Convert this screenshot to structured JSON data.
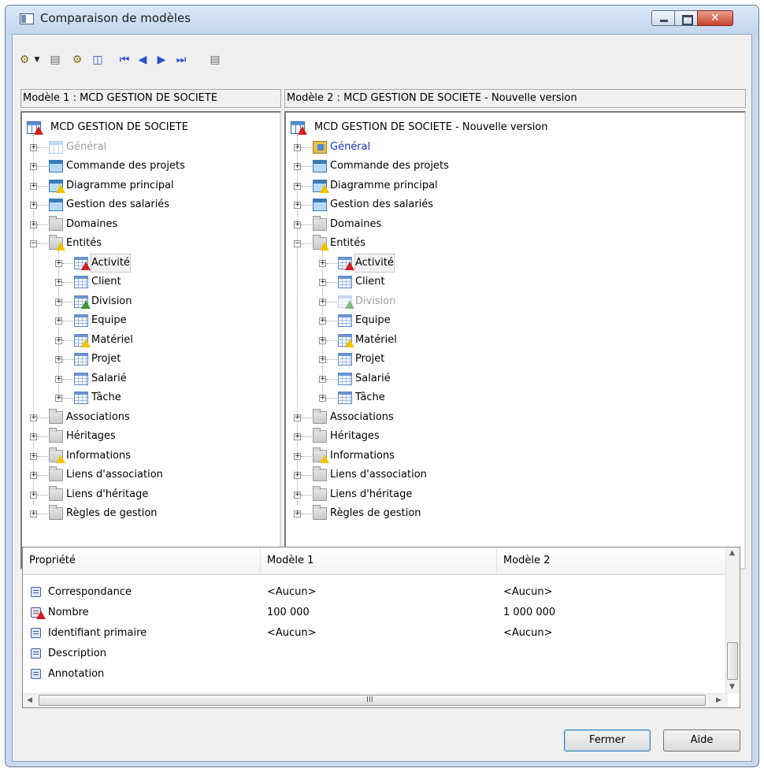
{
  "window": {
    "title": "Comparaison de modèles"
  },
  "toolbar": {
    "icons": [
      "options-icon",
      "dropdown-icon",
      "properties-icon",
      "filter-icon",
      "split-icon",
      "first-icon",
      "previous-icon",
      "next-icon",
      "last-icon",
      "report-icon"
    ]
  },
  "model1": {
    "header": "Modèle 1 : MCD GESTION DE SOCIETE",
    "root": "MCD GESTION DE SOCIETE",
    "items": [
      {
        "label": "Général",
        "icon": "model",
        "state": "faded",
        "level": 1
      },
      {
        "label": "Commande des projets",
        "icon": "diagram",
        "state": "normal",
        "level": 1
      },
      {
        "label": "Diagramme principal",
        "icon": "diagram",
        "state": "warn",
        "level": 1
      },
      {
        "label": "Gestion des salariés",
        "icon": "diagram",
        "state": "normal",
        "level": 1
      },
      {
        "label": "Domaines",
        "icon": "folder",
        "state": "normal",
        "level": 1
      },
      {
        "label": "Entités",
        "icon": "folder",
        "state": "warn",
        "level": 1,
        "expanded": true
      },
      {
        "label": "Activité",
        "icon": "table",
        "state": "error",
        "level": 2,
        "selected": true
      },
      {
        "label": "Client",
        "icon": "table",
        "state": "normal",
        "level": 2
      },
      {
        "label": "Division",
        "icon": "table",
        "state": "added",
        "level": 2
      },
      {
        "label": "Equipe",
        "icon": "table",
        "state": "normal",
        "level": 2
      },
      {
        "label": "Matériel",
        "icon": "table",
        "state": "warn",
        "level": 2
      },
      {
        "label": "Projet",
        "icon": "table",
        "state": "normal",
        "level": 2
      },
      {
        "label": "Salarié",
        "icon": "table",
        "state": "normal",
        "level": 2
      },
      {
        "label": "Tâche",
        "icon": "table",
        "state": "normal",
        "level": 2
      },
      {
        "label": "Associations",
        "icon": "folder",
        "state": "normal",
        "level": 1
      },
      {
        "label": "Héritages",
        "icon": "folder",
        "state": "normal",
        "level": 1
      },
      {
        "label": "Informations",
        "icon": "folder",
        "state": "warn",
        "level": 1
      },
      {
        "label": "Liens d'association",
        "icon": "folder",
        "state": "normal",
        "level": 1
      },
      {
        "label": "Liens d'héritage",
        "icon": "folder",
        "state": "normal",
        "level": 1
      },
      {
        "label": "Règles de gestion",
        "icon": "folder",
        "state": "normal",
        "level": 1
      }
    ]
  },
  "model2": {
    "header": "Modèle 2 : MCD GESTION DE SOCIETE - Nouvelle version",
    "root": "MCD GESTION DE SOCIETE - Nouvelle version",
    "items": [
      {
        "label": "Général",
        "icon": "pkg",
        "state": "blue",
        "level": 1
      },
      {
        "label": "Commande des projets",
        "icon": "diagram",
        "state": "normal",
        "level": 1
      },
      {
        "label": "Diagramme principal",
        "icon": "diagram",
        "state": "warn",
        "level": 1
      },
      {
        "label": "Gestion des salariés",
        "icon": "diagram",
        "state": "normal",
        "level": 1
      },
      {
        "label": "Domaines",
        "icon": "folder",
        "state": "normal",
        "level": 1
      },
      {
        "label": "Entités",
        "icon": "folder",
        "state": "warn",
        "level": 1,
        "expanded": true
      },
      {
        "label": "Activité",
        "icon": "table",
        "state": "error",
        "level": 2,
        "selected": true
      },
      {
        "label": "Client",
        "icon": "table",
        "state": "normal",
        "level": 2
      },
      {
        "label": "Division",
        "icon": "table",
        "state": "removed",
        "level": 2
      },
      {
        "label": "Equipe",
        "icon": "table",
        "state": "normal",
        "level": 2
      },
      {
        "label": "Matériel",
        "icon": "table",
        "state": "warn",
        "level": 2
      },
      {
        "label": "Projet",
        "icon": "table",
        "state": "normal",
        "level": 2
      },
      {
        "label": "Salarié",
        "icon": "table",
        "state": "normal",
        "level": 2
      },
      {
        "label": "Tâche",
        "icon": "table",
        "state": "normal",
        "level": 2
      },
      {
        "label": "Associations",
        "icon": "folder",
        "state": "normal",
        "level": 1
      },
      {
        "label": "Héritages",
        "icon": "folder",
        "state": "normal",
        "level": 1
      },
      {
        "label": "Informations",
        "icon": "folder",
        "state": "warn",
        "level": 1
      },
      {
        "label": "Liens d'association",
        "icon": "folder",
        "state": "normal",
        "level": 1
      },
      {
        "label": "Liens d'héritage",
        "icon": "folder",
        "state": "normal",
        "level": 1
      },
      {
        "label": "Règles de gestion",
        "icon": "folder",
        "state": "normal",
        "level": 1
      }
    ]
  },
  "properties": {
    "columns": [
      "Propriété",
      "Modèle 1",
      "Modèle 2"
    ],
    "rows": [
      {
        "name": "Correspondance",
        "m1": "<Aucun>",
        "m2": "<Aucun>",
        "icon": "property-icon"
      },
      {
        "name": "Nombre",
        "m1": "100 000",
        "m2": "1 000 000",
        "icon": "error-property-icon"
      },
      {
        "name": "Identifiant primaire",
        "m1": "<Aucun>",
        "m2": "<Aucun>",
        "icon": "property-icon"
      },
      {
        "name": "Description",
        "m1": "",
        "m2": "",
        "icon": "property-icon"
      },
      {
        "name": "Annotation",
        "m1": "",
        "m2": "",
        "icon": "property-icon"
      }
    ],
    "scroll_glyph": "III"
  },
  "buttons": {
    "close": "Fermer",
    "help": "Aide"
  },
  "colors": {
    "warning": "#f2c400",
    "error": "#d01f1f",
    "added": "#3c9a2c",
    "changed_text": "#1532c8",
    "missing_text": "#a0a0a0"
  }
}
